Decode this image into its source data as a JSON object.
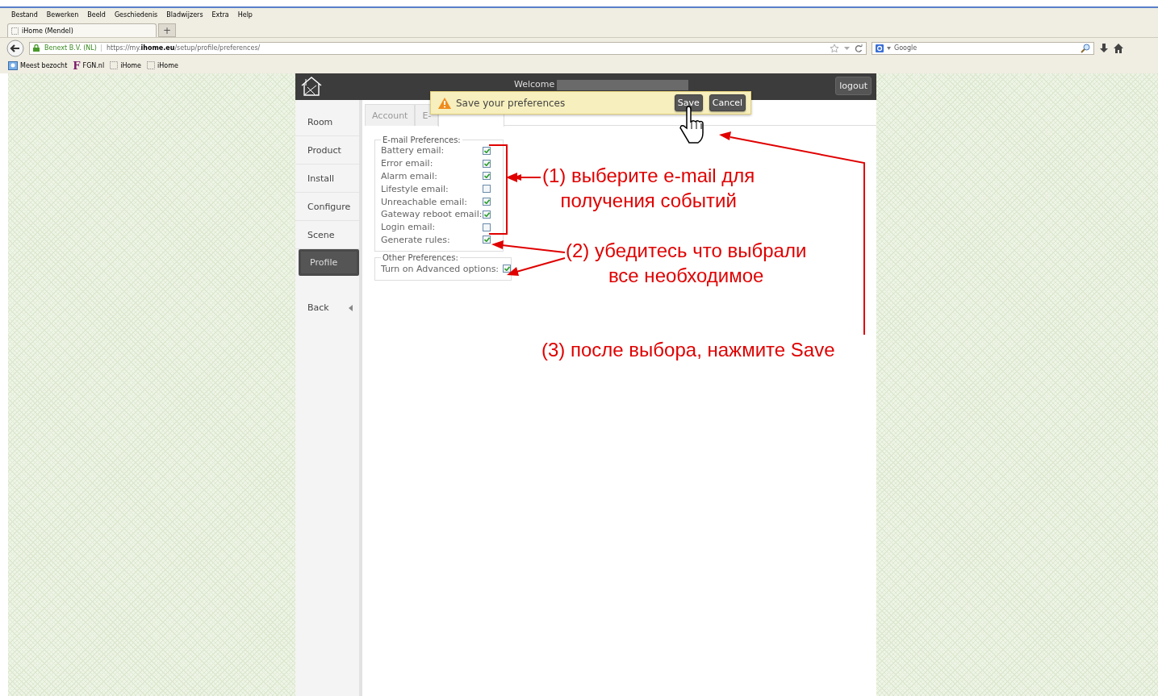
{
  "browser": {
    "menu": [
      "Bestand",
      "Bewerken",
      "Beeld",
      "Geschiedenis",
      "Bladwijzers",
      "Extra",
      "Help"
    ],
    "tabs": [
      {
        "label": "iHome (Mendel)",
        "selected": true
      }
    ],
    "new_tab": "+",
    "identity": "Benext B.V. (NL)",
    "url": "https://my.**ihome.eu**/setup/profile/preferences/",
    "search": {
      "placeholder": "Google"
    },
    "bookmarks": [
      {
        "kind": "folder",
        "label": "Meest bezocht"
      },
      {
        "kind": "letter",
        "icon_text": "F",
        "label": "FGN.nl"
      },
      {
        "kind": "blank",
        "label": "iHome"
      },
      {
        "kind": "blank",
        "label": "iHome"
      }
    ]
  },
  "app": {
    "welcome": "Welcome",
    "logout": "logout",
    "sidebar": [
      {
        "label": "Room",
        "selected": false
      },
      {
        "label": "Product",
        "selected": false
      },
      {
        "label": "Install",
        "selected": false
      },
      {
        "label": "Configure",
        "selected": false
      },
      {
        "label": "Scene",
        "selected": false
      },
      {
        "label": "Profile",
        "selected": true
      }
    ],
    "back": "Back",
    "tabs": [
      {
        "label": "Account",
        "selected": false
      },
      {
        "label": "E-",
        "selected": false
      },
      {
        "selected": true
      }
    ],
    "notification": {
      "message": "Save your preferences",
      "buttons": [
        "Save",
        "Cancel"
      ]
    },
    "groups": [
      {
        "title": "E-mail Preferences:",
        "options": [
          {
            "label": "Battery email:",
            "checked": true
          },
          {
            "label": "Error email:",
            "checked": true
          },
          {
            "label": "Alarm email:",
            "checked": true
          },
          {
            "label": "Lifestyle email:",
            "checked": false
          },
          {
            "label": "Unreachable email:",
            "checked": true
          },
          {
            "label": "Gateway reboot email:",
            "checked": true
          },
          {
            "label": "Login email:",
            "checked": false
          },
          {
            "label": "Generate rules:",
            "checked": true
          }
        ]
      },
      {
        "title": "Other Preferences:",
        "options": [
          {
            "label": "Turn on Advanced options:",
            "checked": true
          }
        ]
      }
    ]
  },
  "annotations": [
    {
      "lines": [
        "(1) выберите e-mail для",
        "получения событий"
      ]
    },
    {
      "lines": [
        "(2) убедитесь что выбрали",
        "все необходимое"
      ]
    },
    {
      "lines": [
        "(3) после выбора, нажмите Save"
      ]
    }
  ]
}
